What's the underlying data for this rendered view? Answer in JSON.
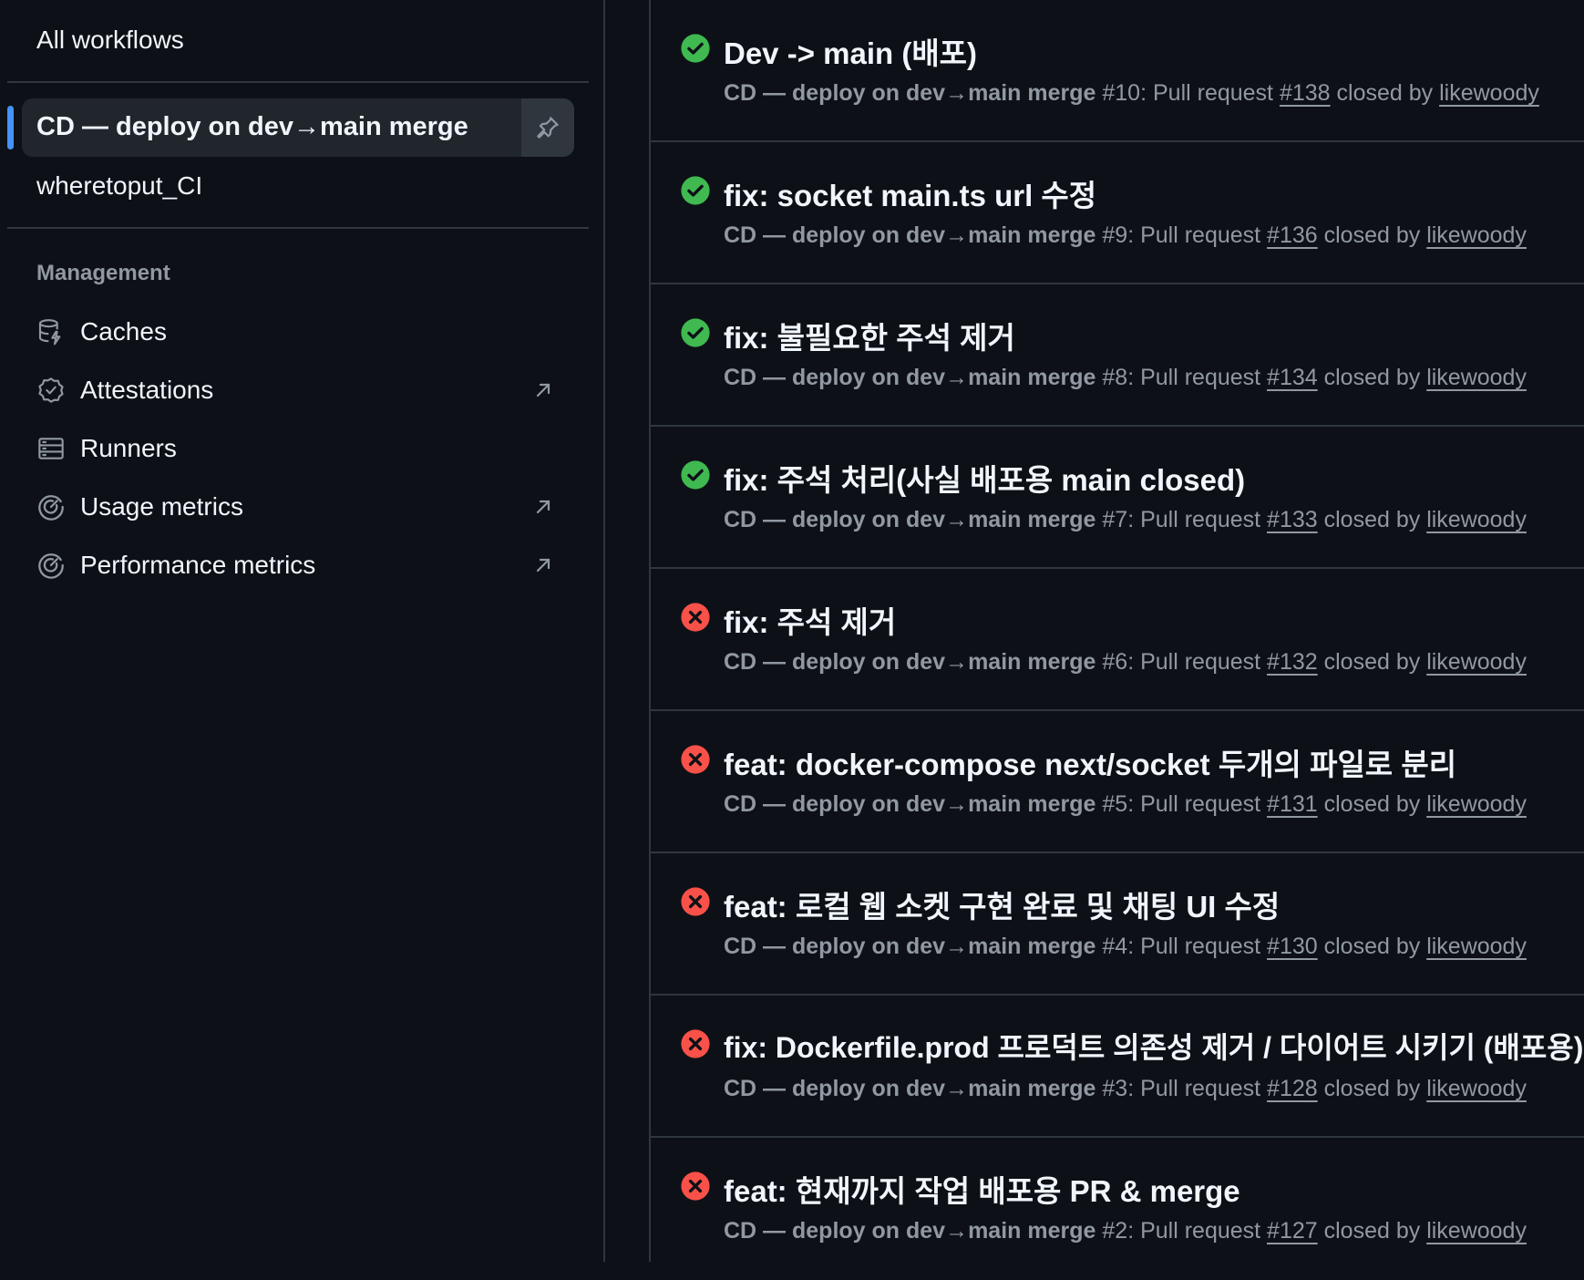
{
  "sidebar": {
    "all_workflows": "All workflows",
    "workflows": [
      {
        "label": "CD — deploy on dev→main merge",
        "selected": true
      },
      {
        "label": "wheretoput_CI",
        "selected": false
      }
    ],
    "management_heading": "Management",
    "management_items": [
      {
        "label": "Caches",
        "icon": "database-icon",
        "external": false
      },
      {
        "label": "Attestations",
        "icon": "verified-badge-icon",
        "external": true
      },
      {
        "label": "Runners",
        "icon": "server-icon",
        "external": false
      },
      {
        "label": "Usage metrics",
        "icon": "meter-icon",
        "external": true
      },
      {
        "label": "Performance metrics",
        "icon": "meter-icon",
        "external": true
      }
    ]
  },
  "colors": {
    "background": "#0d1117",
    "success": "#3fb950",
    "failure": "#f85149",
    "accent": "#4493f8",
    "muted_text": "#9198a1"
  },
  "runs": [
    {
      "status": "success",
      "title": "Dev -> main (배포)",
      "workflow": "CD — deploy on dev→main merge",
      "run_number": "#10",
      "event": ": Pull request ",
      "pr": "#138",
      "closed_by": " closed by ",
      "user": "likewoody"
    },
    {
      "status": "success",
      "title": "fix: socket main.ts url 수정",
      "workflow": "CD — deploy on dev→main merge",
      "run_number": "#9",
      "event": ": Pull request ",
      "pr": "#136",
      "closed_by": " closed by ",
      "user": "likewoody"
    },
    {
      "status": "success",
      "title": "fix: 불필요한 주석 제거",
      "workflow": "CD — deploy on dev→main merge",
      "run_number": "#8",
      "event": ": Pull request ",
      "pr": "#134",
      "closed_by": " closed by ",
      "user": "likewoody"
    },
    {
      "status": "success",
      "title": "fix: 주석 처리(사실 배포용 main closed)",
      "workflow": "CD — deploy on dev→main merge",
      "run_number": "#7",
      "event": ": Pull request ",
      "pr": "#133",
      "closed_by": " closed by ",
      "user": "likewoody"
    },
    {
      "status": "failure",
      "title": "fix: 주석 제거",
      "workflow": "CD — deploy on dev→main merge",
      "run_number": "#6",
      "event": ": Pull request ",
      "pr": "#132",
      "closed_by": " closed by ",
      "user": "likewoody"
    },
    {
      "status": "failure",
      "title": "feat: docker-compose next/socket 두개의 파일로 분리",
      "workflow": "CD — deploy on dev→main merge",
      "run_number": "#5",
      "event": ": Pull request ",
      "pr": "#131",
      "closed_by": " closed by ",
      "user": "likewoody"
    },
    {
      "status": "failure",
      "title": "feat: 로컬 웹 소켓 구현 완료 및 채팅 UI 수정",
      "workflow": "CD — deploy on dev→main merge",
      "run_number": "#4",
      "event": ": Pull request ",
      "pr": "#130",
      "closed_by": " closed by ",
      "user": "likewoody"
    },
    {
      "status": "failure",
      "title": "fix: Dockerfile.prod 프로덕트 의존성 제거 / 다이어트 시키기 (배포용)",
      "workflow": "CD — deploy on dev→main merge",
      "run_number": "#3",
      "event": ": Pull request ",
      "pr": "#128",
      "closed_by": " closed by ",
      "user": "likewoody"
    },
    {
      "status": "failure",
      "title": "feat: 현재까지 작업 배포용 PR & merge",
      "workflow": "CD — deploy on dev→main merge",
      "run_number": "#2",
      "event": ": Pull request ",
      "pr": "#127",
      "closed_by": " closed by ",
      "user": "likewoody"
    }
  ]
}
